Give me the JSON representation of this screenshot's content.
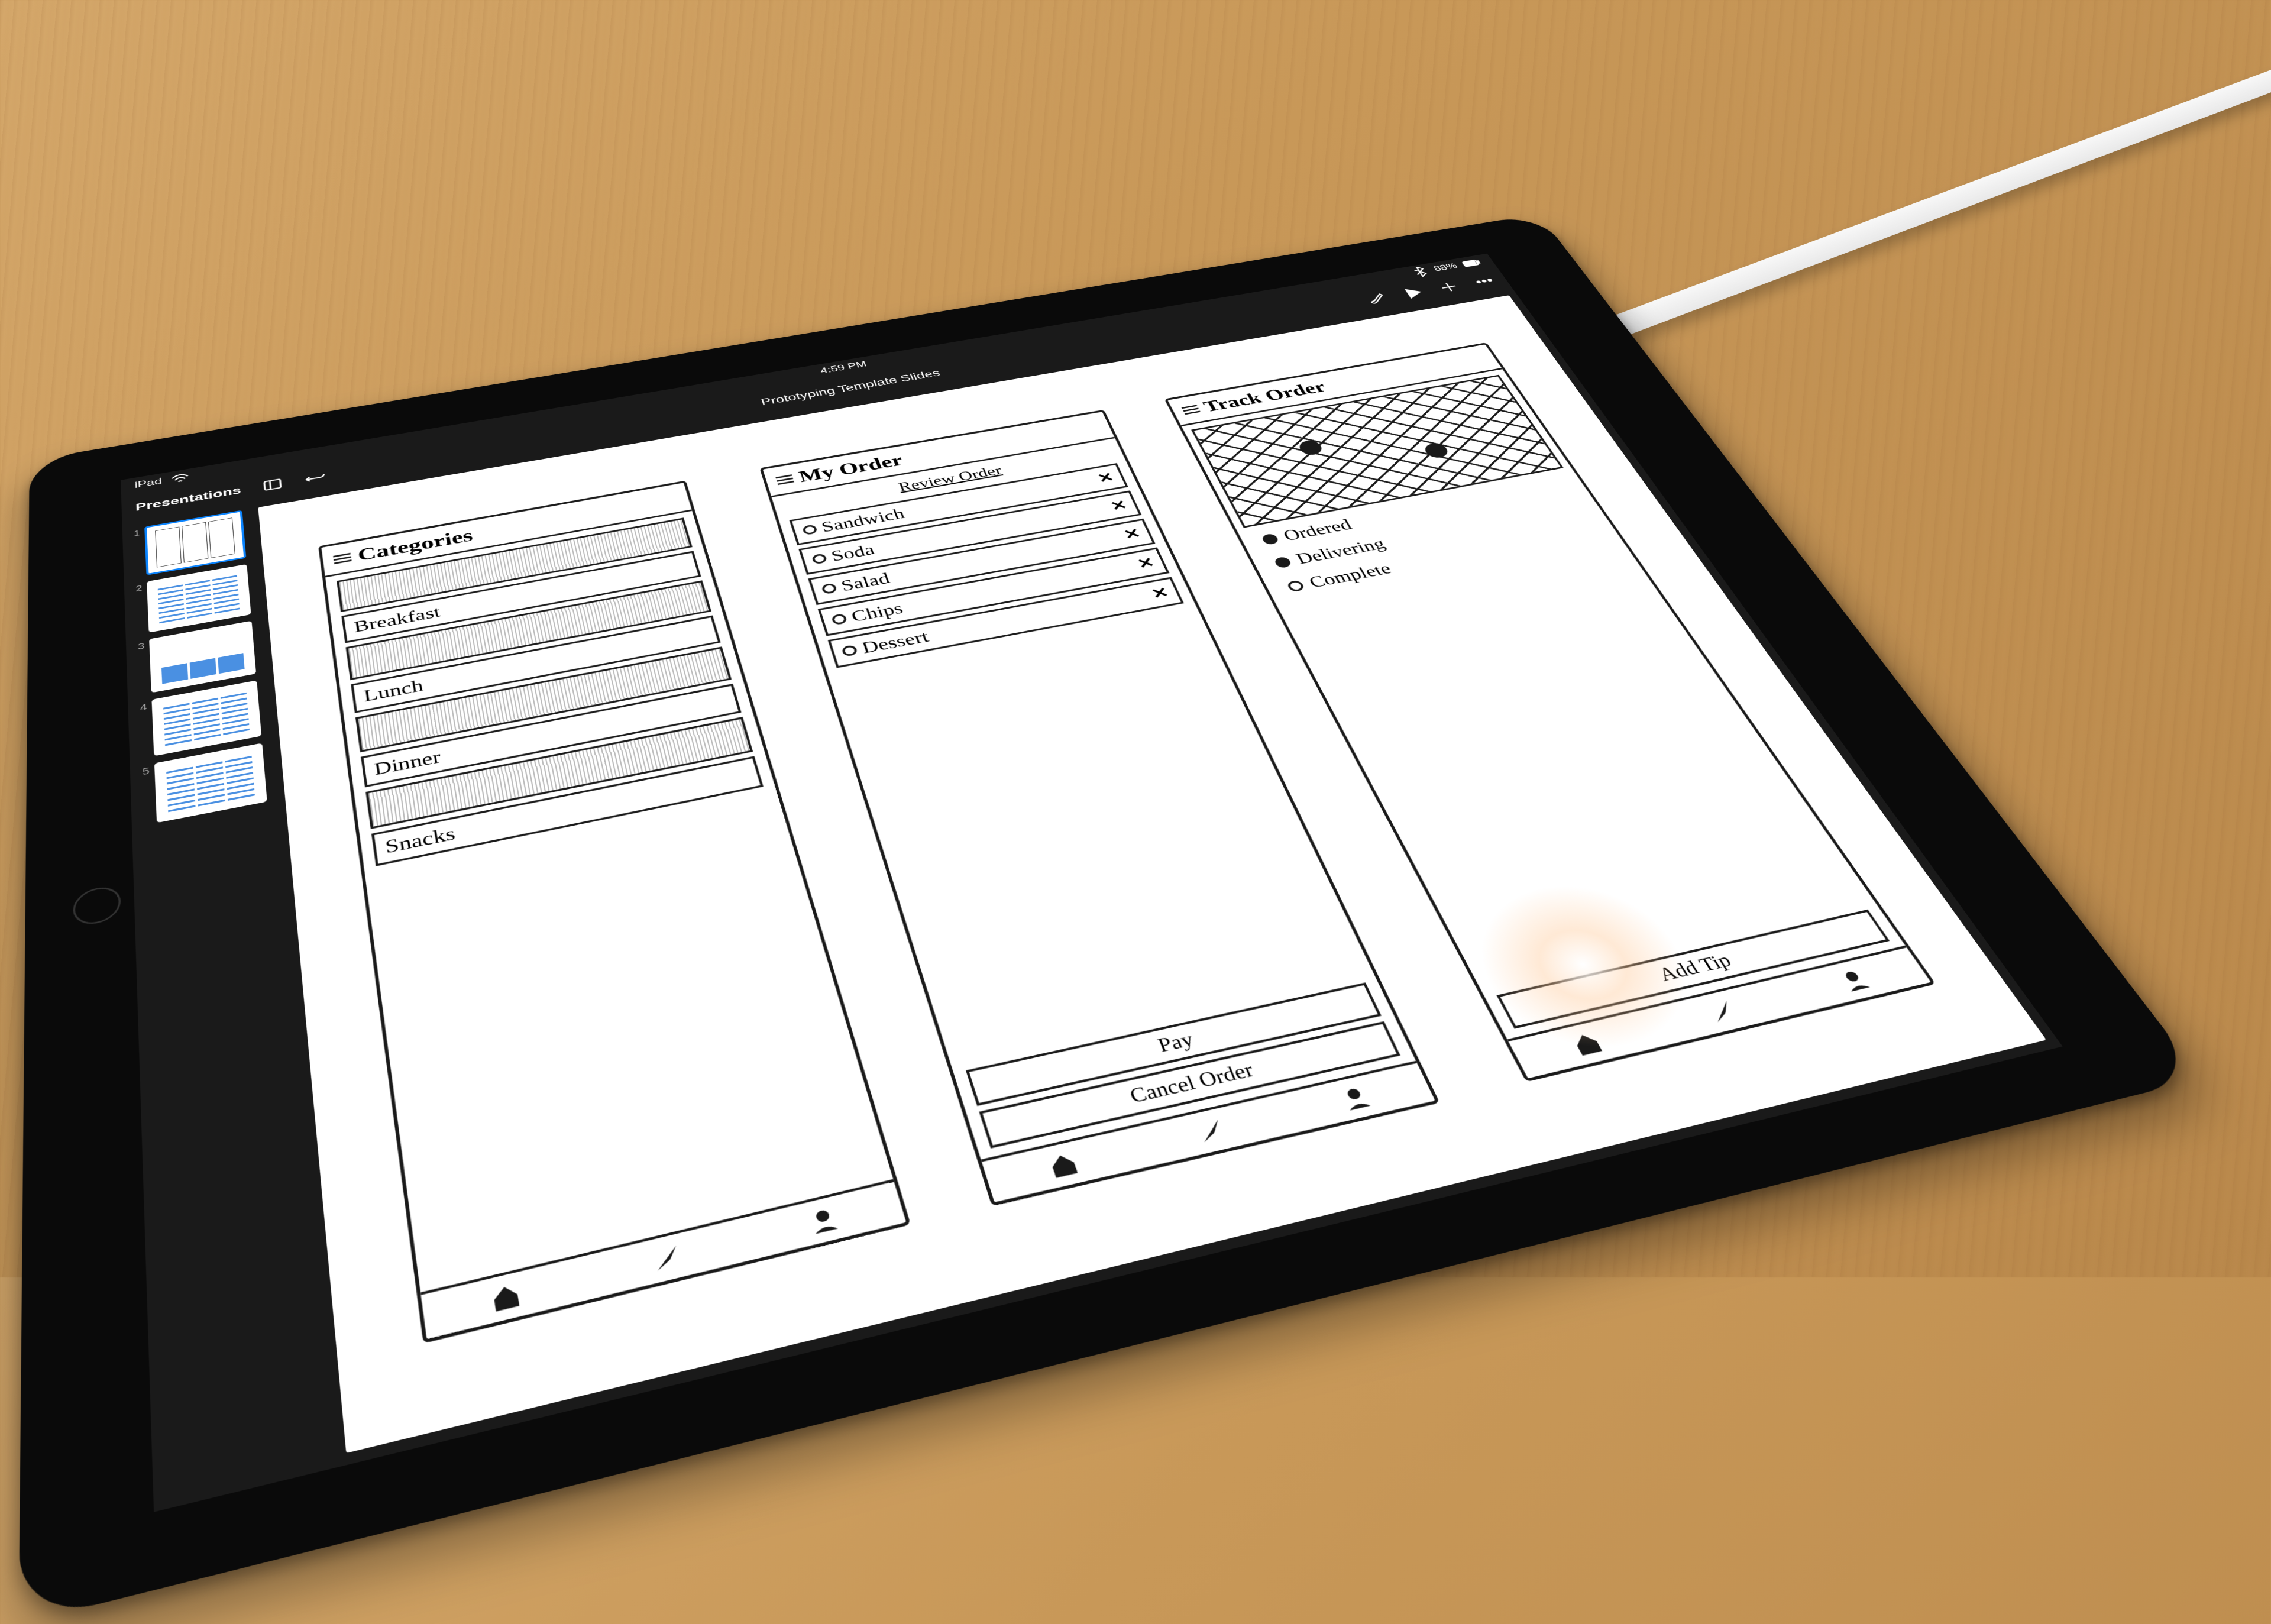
{
  "statusbar": {
    "device": "iPad",
    "time": "4:59 PM",
    "battery": "88%"
  },
  "toolbar": {
    "back_label": "Presentations"
  },
  "document": {
    "title": "Prototyping Template Slides"
  },
  "thumbnails": [
    {
      "num": "1",
      "selected": true
    },
    {
      "num": "2",
      "selected": false
    },
    {
      "num": "3",
      "selected": false
    },
    {
      "num": "4",
      "selected": false
    },
    {
      "num": "5",
      "selected": false
    }
  ],
  "wireframes": {
    "categories": {
      "title": "Categories",
      "items": [
        "Breakfast",
        "Lunch",
        "Dinner",
        "Snacks"
      ]
    },
    "my_order": {
      "title": "My Order",
      "subhead": "Review Order",
      "items": [
        "Sandwich",
        "Soda",
        "Salad",
        "Chips",
        "Dessert"
      ],
      "pay": "Pay",
      "cancel": "Cancel Order"
    },
    "track_order": {
      "title": "Track Order",
      "steps": [
        "Ordered",
        "Delivering",
        "Complete"
      ],
      "tip_button": "Add Tip"
    }
  }
}
